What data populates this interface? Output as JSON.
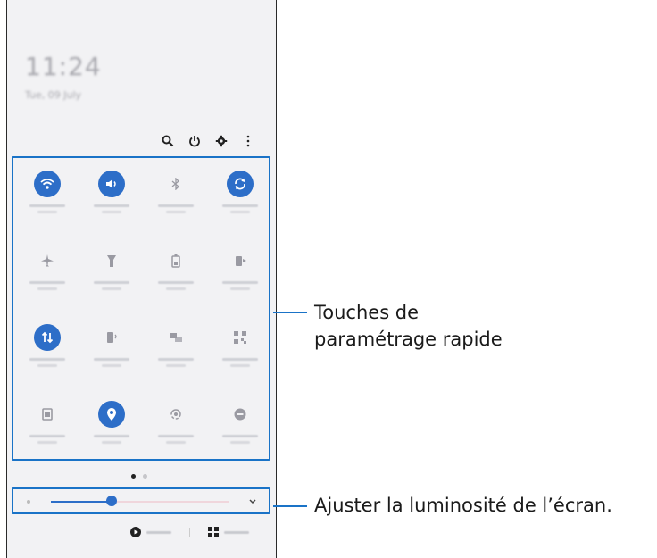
{
  "lock": {
    "time": "11:24",
    "date": "Tue, 09 July"
  },
  "topbar": {
    "icons": [
      "search-icon",
      "power-icon",
      "gear-icon",
      "more-icon"
    ]
  },
  "tiles": [
    {
      "name": "wifi",
      "icon": "wifi-icon",
      "on": true
    },
    {
      "name": "sound",
      "icon": "sound-icon",
      "on": true
    },
    {
      "name": "bluetooth",
      "icon": "bluetooth-icon",
      "on": false
    },
    {
      "name": "auto-rotate",
      "icon": "rotate-icon",
      "on": true
    },
    {
      "name": "airplane",
      "icon": "airplane-icon",
      "on": false
    },
    {
      "name": "flashlight",
      "icon": "flashlight-icon",
      "on": false
    },
    {
      "name": "power-saving",
      "icon": "battery-icon",
      "on": false
    },
    {
      "name": "wireless-powershare",
      "icon": "powershare-icon",
      "on": false
    },
    {
      "name": "mobile-data",
      "icon": "data-icon",
      "on": true
    },
    {
      "name": "mobile-hotspot",
      "icon": "hotspot-icon",
      "on": false
    },
    {
      "name": "link-to-windows",
      "icon": "link-icon",
      "on": false
    },
    {
      "name": "scan-qr",
      "icon": "qr-icon",
      "on": false
    },
    {
      "name": "secure-folder",
      "icon": "folder-icon",
      "on": false
    },
    {
      "name": "location",
      "icon": "location-icon",
      "on": true
    },
    {
      "name": "smart-view",
      "icon": "smartview-icon",
      "on": false
    },
    {
      "name": "do-not-disturb",
      "icon": "dnd-icon",
      "on": false
    }
  ],
  "brightness": {
    "level": 0.34
  },
  "colors": {
    "accent": "#2d6ec8",
    "callout": "#1a73c7"
  },
  "callouts": {
    "quick_settings_line1": "Touches de",
    "quick_settings_line2": "paramétrage rapide",
    "brightness": "Ajuster la luminosité de l’écran."
  }
}
